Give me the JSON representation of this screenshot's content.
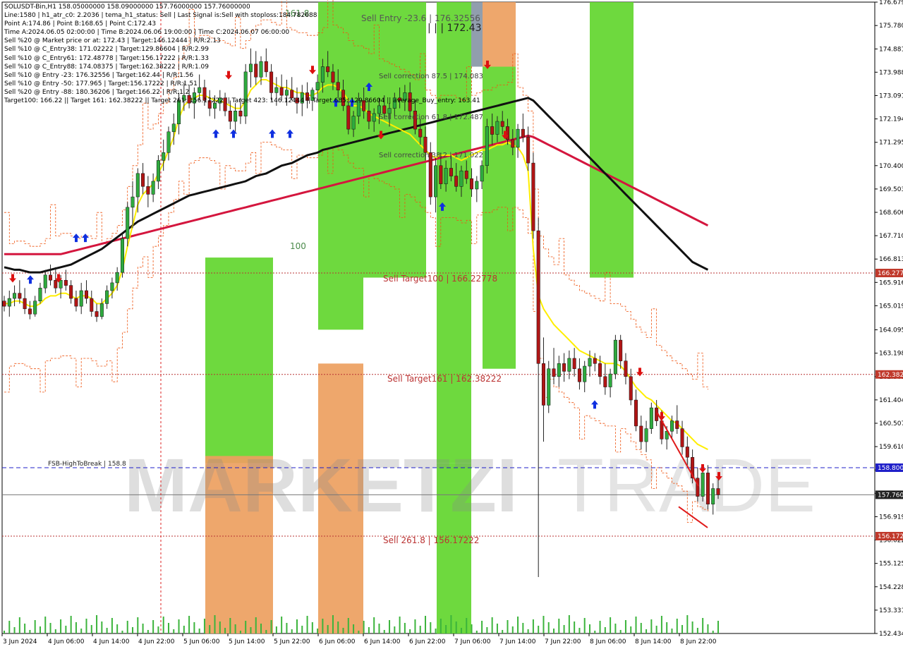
{
  "window": {
    "symbol_line": "SOLUSDT-Bin,H1  158.05000000 158.09000000 157.76000000 157.76000000"
  },
  "info_lines": [
    "Line:1580 | h1_atr_c0: 2.2036 | tema_h1_status: Sell | Last Signal is:Sell with stoploss:184.782688",
    "Point A:174.86 | Point B:168.65 | Point C:172.43",
    "Time A:2024.06.05 02:00:00 | Time B:2024.06.06 19:00:00 | Time C:2024.06.07 06:00:00",
    "Sell %20 @ Market price or at: 172.43 | Target:146.12444 | R/R:2.13",
    "Sell %10 @ C_Entry38: 171.02222 | Target:129.86604 | R/R:2.99",
    "Sell %10 @ C_Entry61: 172.48778 | Target:156.17222 | R/R:1.33",
    "Sell %10 @ C_Entry88: 174.08375 | Target:162.38222 | R/R:1.09",
    "Sell %10 @ Entry -23: 176.32556 | Target:162.44 | R/R:1.56",
    "Sell %10 @ Entry -50: 177.965 | Target:156.17222 | R/R:1.51",
    "Sell %20 @ Entry -88: 180.36206 | Target:166.22 | R/R:1.2",
    "Target100: 166.22 || Target 161: 162.38222 || Target 261: 156.17222 || Target 423: 146.12444 || Target 685: 129.86604 || average_Buy_entry: 163.41"
  ],
  "levels": {
    "sell_entry": "Sell Entry -23.6 | 176.32556",
    "c_label": "| | | 172.43",
    "corr_875": "Sell correction 87.5 | 174.083",
    "corr_618": "Sell correction 61.8 | 172.487",
    "corr_382": "Sell correction 38.2 | 171.022",
    "target100": "Sell Target100 | 166.22778",
    "target161": "Sell Target161 | 162.38222",
    "target261": "Sell  261.8 | 156.17222",
    "fsb": "FSB-HighToBreak | 158.8",
    "fib_1618": "161.8",
    "fib_100": "100"
  },
  "price_tags": [
    {
      "label": "166.277",
      "price": 166.277,
      "color": "#c0392b"
    },
    {
      "label": "162.382",
      "price": 162.382,
      "color": "#c0392b"
    },
    {
      "label": "158.800",
      "price": 158.8,
      "color": "#1f1fc9"
    },
    {
      "label": "157.760",
      "price": 157.76,
      "color": "#222222"
    },
    {
      "label": "156.172",
      "price": 156.172,
      "color": "#c0392b"
    }
  ],
  "watermark": {
    "part1": "MARKETZI",
    "part2": "TRADE"
  },
  "colors": {
    "bull": "#2eaa3e",
    "bear": "#b01515",
    "wick": "#222222",
    "green_zone": "#62d62e",
    "orange_zone": "#eda060",
    "tema": "#ffee00",
    "ma_black": "#111111",
    "ma_red": "#d4163e",
    "envelope": "#ee5512",
    "buy_arrow": "#1030e0",
    "sell_arrow": "#dd1010",
    "grid": "#000000"
  },
  "chart_data": {
    "type": "candlestick",
    "title": "SOLUSDT-Bin,H1",
    "ylim": [
      152.434,
      176.679
    ],
    "y_ticks": [
      "176.679",
      "175.780",
      "174.881",
      "173.988",
      "173.091",
      "172.194",
      "171.295",
      "170.400",
      "169.503",
      "168.606",
      "167.710",
      "166.813",
      "165.916",
      "165.019",
      "164.095",
      "163.198",
      "162.301",
      "161.404",
      "160.507",
      "159.610",
      "158.713",
      "157.816",
      "156.919",
      "156.022",
      "155.125",
      "154.228",
      "153.331",
      "152.434"
    ],
    "x_ticks": [
      "3 Jun 2024",
      "4 Jun 06:00",
      "4 Jun 14:00",
      "4 Jun 22:00",
      "5 Jun 06:00",
      "5 Jun 14:00",
      "5 Jun 22:00",
      "6 Jun 06:00",
      "6 Jun 14:00",
      "6 Jun 22:00",
      "7 Jun 06:00",
      "7 Jun 14:00",
      "7 Jun 22:00",
      "8 Jun 06:00",
      "8 Jun 14:00",
      "8 Jun 22:00"
    ],
    "candles": [
      [
        165.2,
        165.4,
        164.8,
        165.0
      ],
      [
        165.0,
        165.6,
        164.6,
        165.3
      ],
      [
        165.3,
        165.8,
        165.0,
        165.5
      ],
      [
        165.5,
        166.0,
        165.1,
        165.3
      ],
      [
        165.3,
        165.7,
        164.7,
        164.9
      ],
      [
        164.9,
        165.2,
        164.5,
        164.7
      ],
      [
        164.7,
        165.4,
        164.6,
        165.2
      ],
      [
        165.2,
        165.9,
        165.1,
        165.7
      ],
      [
        165.7,
        166.4,
        165.5,
        166.2
      ],
      [
        166.2,
        166.6,
        165.8,
        166.0
      ],
      [
        166.0,
        166.5,
        165.5,
        165.7
      ],
      [
        165.7,
        166.2,
        165.3,
        166.0
      ],
      [
        166.0,
        166.4,
        165.6,
        165.8
      ],
      [
        165.8,
        166.0,
        165.1,
        165.3
      ],
      [
        165.3,
        165.6,
        164.8,
        165.0
      ],
      [
        165.0,
        165.9,
        164.7,
        165.6
      ],
      [
        165.6,
        166.0,
        165.1,
        165.3
      ],
      [
        165.3,
        165.6,
        164.6,
        164.8
      ],
      [
        164.8,
        165.1,
        164.4,
        164.6
      ],
      [
        164.6,
        165.3,
        164.5,
        165.1
      ],
      [
        165.1,
        165.8,
        164.9,
        165.6
      ],
      [
        165.6,
        166.1,
        165.3,
        165.9
      ],
      [
        165.9,
        166.5,
        165.6,
        166.3
      ],
      [
        166.3,
        167.8,
        166.1,
        167.6
      ],
      [
        167.6,
        169.0,
        167.3,
        168.8
      ],
      [
        168.8,
        169.8,
        168.0,
        169.2
      ],
      [
        169.2,
        170.3,
        168.6,
        170.1
      ],
      [
        170.1,
        170.5,
        169.3,
        169.6
      ],
      [
        169.6,
        170.0,
        168.8,
        169.3
      ],
      [
        169.3,
        170.1,
        169.0,
        169.8
      ],
      [
        169.8,
        170.8,
        169.5,
        170.6
      ],
      [
        170.6,
        171.4,
        170.2,
        170.9
      ],
      [
        170.9,
        171.9,
        170.6,
        171.7
      ],
      [
        171.7,
        172.4,
        171.2,
        172.0
      ],
      [
        172.0,
        173.2,
        171.6,
        172.9
      ],
      [
        172.9,
        173.6,
        172.5,
        173.1
      ],
      [
        173.1,
        173.5,
        172.6,
        172.8
      ],
      [
        172.8,
        173.4,
        172.2,
        173.2
      ],
      [
        173.2,
        173.9,
        172.9,
        173.4
      ],
      [
        173.4,
        173.7,
        172.7,
        172.9
      ],
      [
        172.9,
        173.3,
        172.3,
        172.6
      ],
      [
        172.6,
        173.1,
        172.2,
        172.8
      ],
      [
        172.8,
        173.3,
        172.5,
        173.0
      ],
      [
        173.0,
        173.2,
        172.3,
        172.5
      ],
      [
        172.5,
        172.9,
        171.8,
        172.1
      ],
      [
        172.1,
        172.8,
        171.7,
        172.5
      ],
      [
        172.5,
        173.0,
        172.0,
        172.3
      ],
      [
        172.3,
        174.3,
        172.0,
        174.0
      ],
      [
        174.0,
        174.9,
        173.4,
        174.3
      ],
      [
        174.3,
        174.8,
        173.5,
        173.8
      ],
      [
        173.8,
        174.6,
        173.5,
        174.4
      ],
      [
        174.4,
        174.9,
        173.8,
        174.0
      ],
      [
        174.0,
        174.3,
        172.9,
        173.2
      ],
      [
        173.2,
        173.8,
        172.7,
        173.4
      ],
      [
        173.4,
        173.9,
        172.9,
        173.1
      ],
      [
        173.1,
        173.7,
        172.7,
        173.3
      ],
      [
        173.3,
        173.8,
        172.9,
        173.0
      ],
      [
        173.0,
        173.4,
        172.4,
        172.8
      ],
      [
        172.8,
        173.5,
        172.3,
        173.2
      ],
      [
        173.2,
        173.6,
        172.6,
        172.9
      ],
      [
        172.9,
        173.4,
        172.5,
        173.3
      ],
      [
        173.3,
        173.9,
        172.9,
        173.6
      ],
      [
        173.6,
        174.5,
        173.2,
        174.2
      ],
      [
        174.2,
        174.8,
        173.8,
        174.0
      ],
      [
        174.0,
        174.3,
        173.3,
        173.6
      ],
      [
        173.6,
        174.1,
        173.0,
        173.3
      ],
      [
        173.3,
        173.7,
        172.5,
        172.7
      ],
      [
        172.7,
        173.0,
        171.6,
        171.8
      ],
      [
        171.8,
        172.5,
        171.5,
        172.3
      ],
      [
        172.3,
        173.2,
        172.0,
        172.9
      ],
      [
        172.9,
        173.4,
        172.2,
        172.5
      ],
      [
        172.5,
        172.9,
        171.8,
        172.1
      ],
      [
        172.1,
        172.6,
        171.7,
        172.4
      ],
      [
        172.4,
        173.0,
        172.0,
        172.7
      ],
      [
        172.7,
        173.1,
        172.2,
        172.4
      ],
      [
        172.4,
        172.8,
        171.9,
        172.6
      ],
      [
        172.6,
        173.2,
        172.3,
        173.0
      ],
      [
        173.0,
        173.4,
        172.6,
        172.9
      ],
      [
        172.9,
        173.5,
        172.5,
        173.2
      ],
      [
        173.2,
        173.6,
        172.2,
        172.5
      ],
      [
        172.5,
        172.9,
        171.6,
        171.8
      ],
      [
        171.8,
        172.2,
        171.2,
        171.5
      ],
      [
        171.5,
        171.9,
        170.6,
        170.9
      ],
      [
        170.9,
        171.3,
        168.9,
        169.2
      ],
      [
        169.2,
        170.7,
        168.6,
        170.4
      ],
      [
        170.4,
        170.9,
        169.5,
        169.7
      ],
      [
        169.7,
        170.6,
        169.4,
        170.3
      ],
      [
        170.3,
        170.8,
        169.8,
        170.0
      ],
      [
        170.0,
        170.5,
        169.4,
        169.6
      ],
      [
        169.6,
        170.4,
        169.2,
        170.2
      ],
      [
        170.2,
        170.6,
        169.7,
        169.9
      ],
      [
        169.9,
        170.3,
        169.2,
        169.5
      ],
      [
        169.5,
        170.0,
        169.0,
        169.8
      ],
      [
        169.8,
        170.6,
        169.5,
        170.4
      ],
      [
        170.4,
        172.2,
        170.1,
        171.9
      ],
      [
        171.9,
        172.4,
        171.2,
        171.6
      ],
      [
        171.6,
        172.3,
        171.3,
        172.1
      ],
      [
        172.1,
        172.5,
        171.6,
        171.9
      ],
      [
        171.9,
        172.2,
        171.2,
        171.4
      ],
      [
        171.4,
        171.8,
        170.8,
        171.1
      ],
      [
        171.1,
        172.0,
        170.7,
        171.8
      ],
      [
        171.8,
        172.4,
        171.3,
        171.5
      ],
      [
        171.5,
        171.9,
        170.2,
        170.5
      ],
      [
        170.5,
        170.9,
        167.6,
        167.9
      ],
      [
        167.9,
        168.4,
        154.6,
        162.8
      ],
      [
        162.8,
        163.8,
        159.8,
        161.2
      ],
      [
        161.2,
        162.9,
        160.9,
        162.6
      ],
      [
        162.6,
        163.4,
        162.0,
        162.3
      ],
      [
        162.3,
        163.1,
        161.9,
        162.8
      ],
      [
        162.8,
        163.2,
        162.1,
        162.5
      ],
      [
        162.5,
        163.3,
        162.2,
        163.0
      ],
      [
        163.0,
        163.4,
        162.3,
        162.6
      ],
      [
        162.6,
        163.0,
        161.8,
        162.1
      ],
      [
        162.1,
        162.9,
        161.7,
        162.7
      ],
      [
        162.7,
        163.3,
        162.3,
        163.0
      ],
      [
        163.0,
        163.2,
        162.5,
        162.8
      ],
      [
        162.8,
        163.1,
        162.0,
        162.3
      ],
      [
        162.3,
        162.8,
        161.6,
        161.9
      ],
      [
        161.9,
        162.6,
        161.5,
        162.4
      ],
      [
        162.4,
        163.9,
        162.2,
        163.7
      ],
      [
        163.7,
        163.9,
        162.6,
        162.9
      ],
      [
        162.9,
        163.2,
        162.0,
        162.3
      ],
      [
        162.3,
        162.6,
        161.2,
        161.4
      ],
      [
        161.4,
        161.8,
        160.2,
        160.4
      ],
      [
        160.4,
        160.8,
        159.5,
        159.8
      ],
      [
        159.8,
        160.6,
        159.4,
        160.3
      ],
      [
        160.3,
        161.3,
        160.1,
        161.1
      ],
      [
        161.1,
        161.4,
        160.4,
        160.6
      ],
      [
        160.6,
        161.0,
        159.7,
        159.9
      ],
      [
        159.9,
        160.4,
        159.5,
        160.2
      ],
      [
        160.2,
        160.8,
        159.9,
        160.6
      ],
      [
        160.6,
        161.2,
        160.1,
        160.3
      ],
      [
        160.3,
        160.6,
        159.3,
        159.6
      ],
      [
        159.6,
        160.0,
        158.9,
        159.2
      ],
      [
        159.2,
        159.5,
        158.2,
        158.4
      ],
      [
        158.4,
        158.8,
        157.5,
        157.7
      ],
      [
        157.7,
        158.9,
        157.5,
        158.6
      ],
      [
        158.6,
        158.9,
        157.2,
        157.4
      ],
      [
        157.4,
        158.2,
        157.0,
        158.0
      ],
      [
        158.0,
        158.4,
        157.6,
        157.76
      ]
    ],
    "tema": [
      165.1,
      165.1,
      165.2,
      165.2,
      165.1,
      165.0,
      165.0,
      165.1,
      165.3,
      165.4,
      165.4,
      165.5,
      165.5,
      165.4,
      165.3,
      165.4,
      165.4,
      165.3,
      165.1,
      165.1,
      165.3,
      165.5,
      165.8,
      166.4,
      167.3,
      168.1,
      168.9,
      169.3,
      169.5,
      169.7,
      170.1,
      170.5,
      171.0,
      171.5,
      172.2,
      172.7,
      172.9,
      173.0,
      173.1,
      173.1,
      173.0,
      172.9,
      172.9,
      172.8,
      172.7,
      172.6,
      172.6,
      172.9,
      173.3,
      173.5,
      173.7,
      173.7,
      173.6,
      173.5,
      173.4,
      173.4,
      173.3,
      173.2,
      173.2,
      173.1,
      173.1,
      173.2,
      173.4,
      173.5,
      173.5,
      173.4,
      173.2,
      172.9,
      172.7,
      172.7,
      172.6,
      172.4,
      172.3,
      172.2,
      172.1,
      172.0,
      171.9,
      171.8,
      171.7,
      171.6,
      171.4,
      171.2,
      171.0,
      170.8,
      170.7,
      170.8,
      170.8,
      170.8,
      170.7,
      170.6,
      170.7,
      170.8,
      170.9,
      171.0,
      171.0,
      171.1,
      171.2,
      171.2,
      171.3,
      171.2,
      171.1,
      170.8,
      170.2,
      167.2,
      165.4,
      164.9,
      164.6,
      164.3,
      164.1,
      163.9,
      163.7,
      163.5,
      163.3,
      163.2,
      163.1,
      163.0,
      162.9,
      162.8,
      162.8,
      162.8,
      162.7,
      162.5,
      162.2,
      161.9,
      161.7,
      161.5,
      161.4,
      161.2,
      161.0,
      160.8,
      160.6,
      160.5,
      160.3,
      160.1,
      159.9,
      159.7,
      159.6,
      159.5
    ],
    "ma_black": [
      166.5,
      166.45,
      166.4,
      166.4,
      166.35,
      166.3,
      166.3,
      166.3,
      166.35,
      166.4,
      166.45,
      166.5,
      166.55,
      166.6,
      166.7,
      166.8,
      166.9,
      167.0,
      167.1,
      167.2,
      167.35,
      167.5,
      167.65,
      167.8,
      167.95,
      168.1,
      168.25,
      168.35,
      168.45,
      168.55,
      168.65,
      168.75,
      168.85,
      168.95,
      169.05,
      169.15,
      169.25,
      169.3,
      169.35,
      169.4,
      169.45,
      169.5,
      169.55,
      169.6,
      169.65,
      169.7,
      169.75,
      169.8,
      169.9,
      170.0,
      170.05,
      170.1,
      170.2,
      170.3,
      170.4,
      170.45,
      170.5,
      170.6,
      170.7,
      170.8,
      170.85,
      170.9,
      171.0,
      171.05,
      171.1,
      171.15,
      171.2,
      171.25,
      171.3,
      171.35,
      171.4,
      171.45,
      171.5,
      171.55,
      171.6,
      171.65,
      171.7,
      171.75,
      171.8,
      171.85,
      171.9,
      171.95,
      172.0,
      172.05,
      172.1,
      172.15,
      172.2,
      172.25,
      172.3,
      172.35,
      172.4,
      172.45,
      172.5,
      172.55,
      172.6,
      172.65,
      172.7,
      172.75,
      172.8,
      172.85,
      172.9,
      172.95,
      173.0,
      172.9,
      172.7,
      172.5,
      172.3,
      172.1,
      171.9,
      171.7,
      171.5,
      171.3,
      171.1,
      170.9,
      170.7,
      170.5,
      170.3,
      170.1,
      169.9,
      169.7,
      169.5,
      169.3,
      169.1,
      168.9,
      168.7,
      168.5,
      168.3,
      168.1,
      167.9,
      167.7,
      167.5,
      167.3,
      167.1,
      166.9,
      166.7,
      166.6,
      166.5,
      166.4
    ],
    "ma_red": [
      167.0,
      167.0,
      167.0,
      167.0,
      167.0,
      167.0,
      167.0,
      167.0,
      167.0,
      167.0,
      167.0,
      167.0,
      167.05,
      167.1,
      167.15,
      167.2,
      167.25,
      167.3,
      167.35,
      167.4,
      167.45,
      167.5,
      167.55,
      167.6,
      167.65,
      167.7,
      167.75,
      167.8,
      167.85,
      167.9,
      167.95,
      168.0,
      168.05,
      168.1,
      168.15,
      168.2,
      168.25,
      168.3,
      168.35,
      168.4,
      168.45,
      168.5,
      168.55,
      168.6,
      168.65,
      168.7,
      168.75,
      168.8,
      168.85,
      168.9,
      168.95,
      169.0,
      169.05,
      169.1,
      169.15,
      169.2,
      169.25,
      169.3,
      169.35,
      169.4,
      169.45,
      169.5,
      169.55,
      169.6,
      169.65,
      169.7,
      169.75,
      169.8,
      169.85,
      169.9,
      169.95,
      170.0,
      170.05,
      170.1,
      170.15,
      170.2,
      170.25,
      170.3,
      170.35,
      170.4,
      170.45,
      170.5,
      170.55,
      170.6,
      170.65,
      170.7,
      170.75,
      170.8,
      170.85,
      170.9,
      170.95,
      171.0,
      171.05,
      171.1,
      171.15,
      171.2,
      171.25,
      171.3,
      171.35,
      171.4,
      171.45,
      171.5,
      171.55,
      171.5,
      171.4,
      171.3,
      171.2,
      171.1,
      171.0,
      170.9,
      170.8,
      170.7,
      170.6,
      170.5,
      170.4,
      170.3,
      170.2,
      170.1,
      170.0,
      169.9,
      169.8,
      169.7,
      169.6,
      169.5,
      169.4,
      169.3,
      169.2,
      169.1,
      169.0,
      168.9,
      168.8,
      168.7,
      168.6,
      168.5,
      168.4,
      168.3,
      168.2,
      168.1
    ]
  }
}
